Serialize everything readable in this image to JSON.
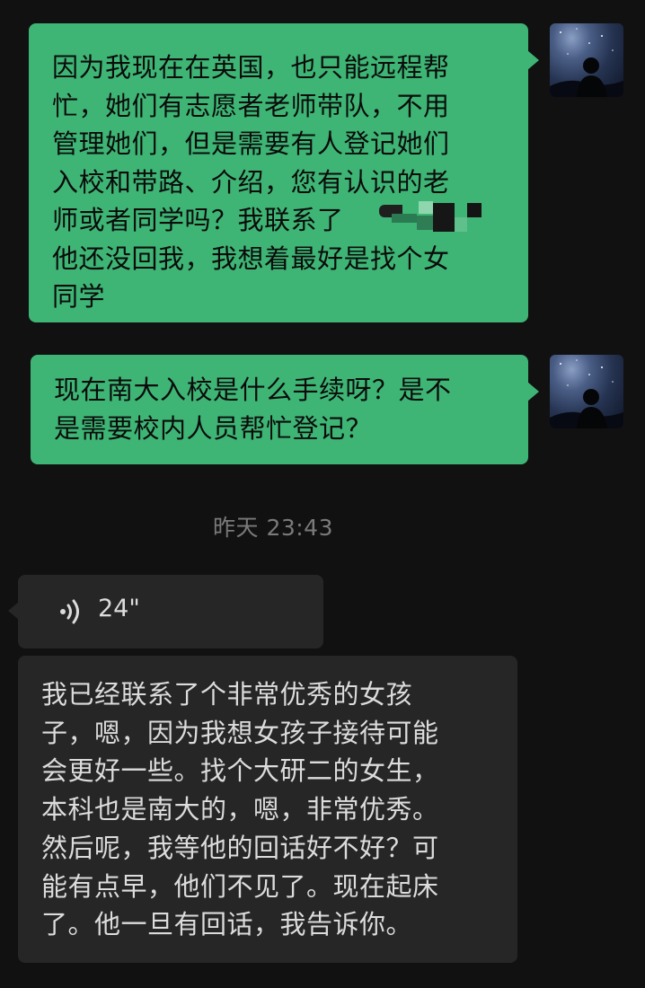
{
  "messages": [
    {
      "sender": "me",
      "lines": [
        "因为我现在在英国，也只能远程帮",
        "忙，她们有志愿者老师带队，不用",
        "管理她们，但是需要有人登记她们",
        "入校和带路、介绍，您有认识的老",
        "师或者同学吗？我联系了",
        "他还没回我，我想着最好是找个女",
        "同学"
      ]
    },
    {
      "sender": "me",
      "lines": [
        "现在南大入校是什么手续呀？是不",
        "是需要校内人员帮忙登记？"
      ]
    }
  ],
  "timestamp": "昨天 23:43",
  "voice_message": {
    "duration": "24\""
  },
  "reply": {
    "lines": [
      "我已经联系了个非常优秀的女孩",
      "子，嗯，因为我想女孩子接待可能",
      "会更好一些。找个大研二的女生，",
      "本科也是南大的，嗯，非常优秀。",
      "然后呢，我等他的回话好不好？可",
      "能有点早，他们不见了。现在起床",
      "了。他一旦有回话，我告诉你。"
    ]
  },
  "colors": {
    "background": "#111111",
    "outgoing_bubble": "#3eb575",
    "incoming_bubble": "#262626",
    "timestamp_text": "#7a7a7a"
  },
  "icons": [
    "avatar-night-sky",
    "voice-wave-icon",
    "redaction-mosaic"
  ]
}
